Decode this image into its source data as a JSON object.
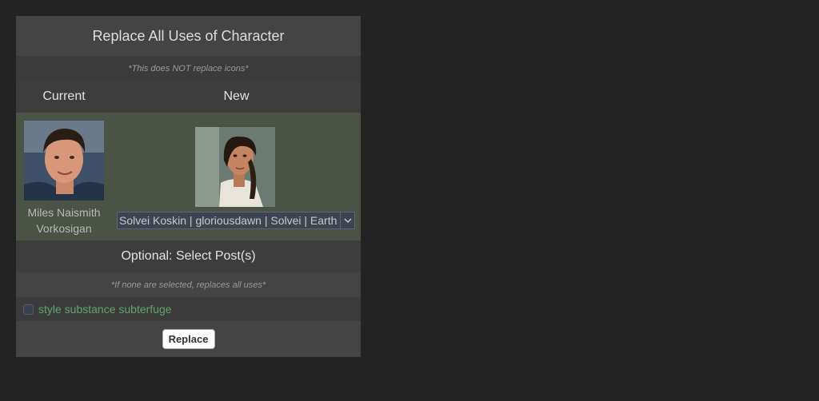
{
  "dialog": {
    "title": "Replace All Uses of Character",
    "note": "*This does NOT replace icons*",
    "columns": {
      "current": "Current",
      "new": "New"
    },
    "current_character": {
      "name_line1": "Miles Naismith",
      "name_line2": "Vorkosigan"
    },
    "new_character": {
      "selected": "Solvei Koskin | gloriousdawn | Solvei | Earth"
    },
    "posts": {
      "title": "Optional: Select Post(s)",
      "note": "*If none are selected, replaces all uses*",
      "items": [
        {
          "label": "style substance subterfuge",
          "checked": false
        }
      ]
    },
    "submit_label": "Replace"
  },
  "colors": {
    "background": "#232323",
    "panel": "#444444",
    "character_row": "#4a5345",
    "post_link": "#5fa56f"
  },
  "icons": {
    "select_arrow": "chevron-down-icon"
  }
}
